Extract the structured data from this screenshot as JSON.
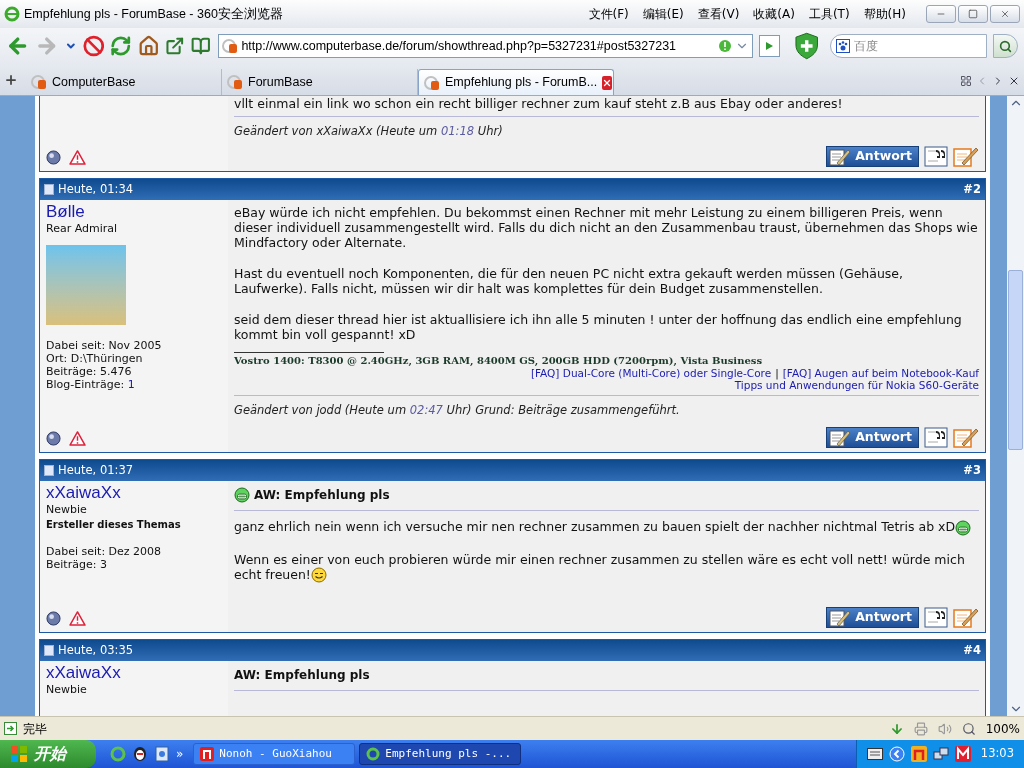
{
  "window": {
    "title": "Empfehlung pls - ForumBase - 360安全浏览器"
  },
  "menu": [
    "文件(F)",
    "编辑(E)",
    "查看(V)",
    "收藏(A)",
    "工具(T)",
    "帮助(H)"
  ],
  "address_bar": {
    "value": "http://www.computerbase.de/forum/showthread.php?p=5327231#post5327231"
  },
  "search": {
    "placeholder": "百度"
  },
  "tabs": [
    {
      "label": "ComputerBase",
      "selected": false
    },
    {
      "label": "ForumBase",
      "selected": false
    },
    {
      "label": "Empfehlung pls - ForumB...",
      "selected": true
    }
  ],
  "posts": [
    {
      "kind": "tail",
      "paragraphs": [
        {
          "text": "vllt einmal ein link wo schon ein recht billiger rechner zum kauf steht z.B aus Ebay oder anderes!"
        }
      ],
      "edited": {
        "before": "Geändert von xXaiwaXx (Heute um",
        "time": "01:18",
        "after": "Uhr)"
      },
      "reply": "Antwort"
    },
    {
      "kind": "full",
      "date": "Heute, 01:34",
      "number": "#2",
      "author": "Bølle",
      "rank": "Rear Admiral",
      "avatar": true,
      "info": [
        {
          "label": "Dabei seit:",
          "value": "Nov 2005",
          "link": false
        },
        {
          "label": "Ort:",
          "value": "D:\\Thüringen",
          "link": false
        },
        {
          "label": "Beiträge:",
          "value": "5.476",
          "link": false
        },
        {
          "label": "Blog-Einträge:",
          "value": "1",
          "link": true
        }
      ],
      "paragraphs": [
        {
          "text": "eBay würde ich nicht empfehlen. Du bekommst einen Rechner mit mehr Leistung zu einem billigeren Preis, wenn dieser individuell zusammengestellt wird. Falls du dich nicht an den Zusammenbau traust, übernehmen das Shops wie Mindfactory oder Alternate."
        },
        {
          "text": "Hast du eventuell noch Komponenten, die für den neuen PC nicht extra gekauft werden müssen (Gehäuse, Laufwerke). Falls nicht, müssen wir dir halt was komplettes für dein Budget zusammenstellen."
        },
        {
          "text": "seid dem dieser thread hier ist aktuallisiere ich ihn alle 5 minuten ! unter der hoffnung das endlich eine empfehlung kommt bin voll gespannt! xD"
        }
      ],
      "signature": {
        "specs": "Vostro 1400: T8300 @ 2.40GHz, 3GB RAM, 8400M GS, 200GB HDD (7200rpm), Vista Business",
        "links": [
          [
            "[FAQ] Dual-Core (Multi-Core) oder Single-Core",
            "|",
            "[FAQ] Augen auf beim Notebook-Kauf"
          ],
          [
            "Tipps und Anwendungen für Nokia S60-Geräte"
          ]
        ]
      },
      "edited": {
        "before": "Geändert von jodd (Heute um",
        "time": "02:47",
        "after": "Uhr) Grund: Beiträge zusammengeführt."
      },
      "reply": "Antwort"
    },
    {
      "kind": "full",
      "date": "Heute, 01:37",
      "number": "#3",
      "author": "xXaiwaXx",
      "rank": "Newbie",
      "subtitle": "Ersteller dieses Themas",
      "info": [
        {
          "label": "Dabei seit:",
          "value": "Dez 2008",
          "link": false
        },
        {
          "label": "Beiträge:",
          "value": "3",
          "link": false
        }
      ],
      "title": {
        "text": "AW: Empfehlung pls",
        "emoticon": {
          "kind": "grin"
        }
      },
      "paragraphs": [
        {
          "text": "ganz ehrlich nein wenn ich versuche mir nen rechner zusammen zu bauen spielt der nachher nichtmal Tetris ab xD",
          "emoticon": {
            "kind": "grin"
          }
        },
        {
          "text": "Wenn es einer von euch probieren würde mir einen rechner zusammen zu stellen wäre es echt voll nett! würde mich echt freuen!",
          "emoticon": {
            "kind": "smile"
          }
        }
      ],
      "reply": "Antwort"
    },
    {
      "kind": "full",
      "date": "Heute, 03:35",
      "number": "#4",
      "author": "xXaiwaXx",
      "rank": "Newbie",
      "title": {
        "text": "AW: Empfehlung pls"
      }
    }
  ],
  "status_bar": {
    "text": "完毕",
    "zoom": "100%"
  },
  "taskbar": {
    "start": "开始",
    "chevron": "»",
    "tasks": [
      {
        "label": "Nonoh - GuoXiahou",
        "selected": false
      },
      {
        "label": "Empfehlung pls -...",
        "selected": true
      }
    ],
    "clock": "13:03"
  }
}
